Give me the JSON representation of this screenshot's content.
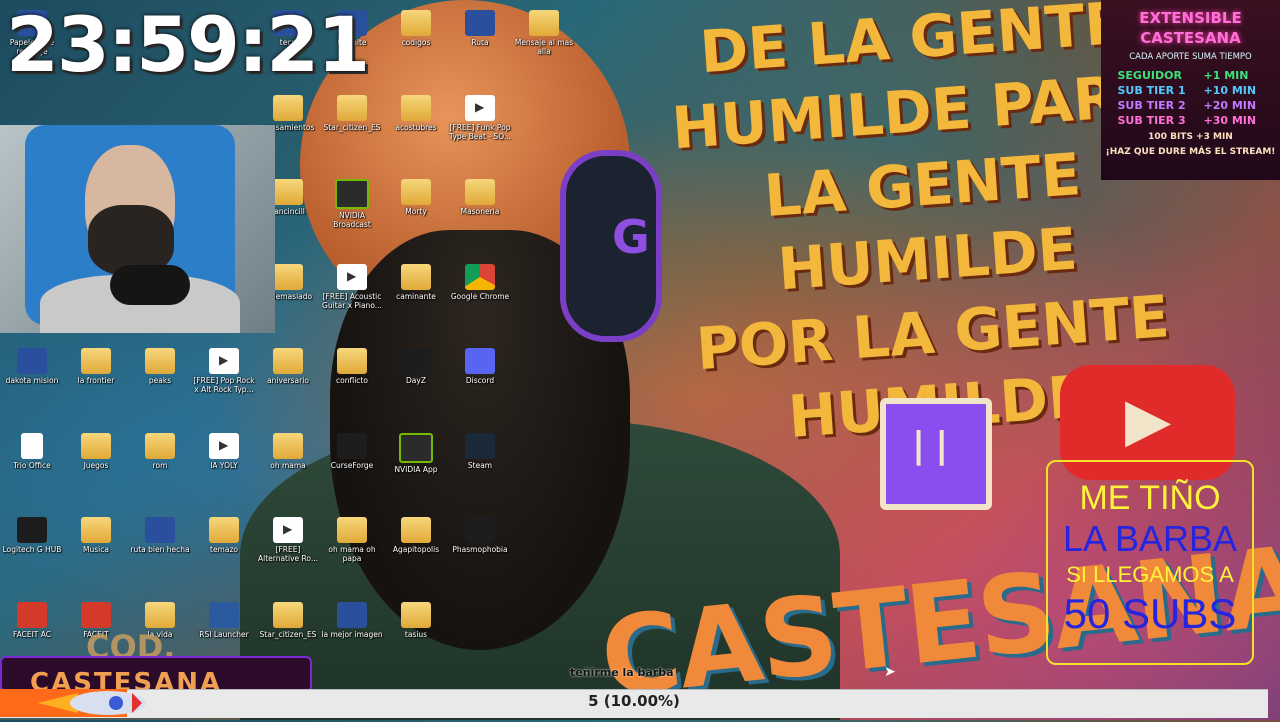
{
  "clock": "23:59:21",
  "slogan": {
    "lines": [
      "DE LA GENTE",
      "HUMILDE PARA",
      "LA GENTE HUMILDE",
      "POR LA GENTE",
      "HUMILDE"
    ]
  },
  "headphone_letter": "G",
  "brand_name": "CASTESANA",
  "desktop_icons": [
    {
      "label": "Papelera de reciclaje",
      "kind": "app"
    },
    {
      "label": "tecn",
      "kind": "app"
    },
    {
      "label": "Fortnite",
      "kind": "app"
    },
    {
      "label": "codigos",
      "kind": "folder"
    },
    {
      "label": "Ruta",
      "kind": "app"
    },
    {
      "label": "Mensaje al mas alla",
      "kind": "folder"
    },
    {
      "label": "pensamientos",
      "kind": "folder"
    },
    {
      "label": "Star_citizen_ES",
      "kind": "folder"
    },
    {
      "label": "acostubres",
      "kind": "folder"
    },
    {
      "label": "[FREE] Funk Pop Type Beat - SO...",
      "kind": "media"
    },
    {
      "label": "rancincill",
      "kind": "folder"
    },
    {
      "label": "NVIDIA Broadcast",
      "kind": "nvidia"
    },
    {
      "label": "Morty",
      "kind": "folder"
    },
    {
      "label": "Masoneria",
      "kind": "folder"
    },
    {
      "label": "e demasiado",
      "kind": "folder"
    },
    {
      "label": "[FREE] Acoustic Guitar x Piano...",
      "kind": "media"
    },
    {
      "label": "caminante",
      "kind": "folder"
    },
    {
      "label": "Google Chrome",
      "kind": "chrome"
    },
    {
      "label": "dakota mision",
      "kind": "app"
    },
    {
      "label": "la frontier",
      "kind": "folder"
    },
    {
      "label": "peaks",
      "kind": "folder"
    },
    {
      "label": "[FREE] Pop Rock x Alt Rock Typ...",
      "kind": "media"
    },
    {
      "label": "aniversario",
      "kind": "folder"
    },
    {
      "label": "conflicto",
      "kind": "folder"
    },
    {
      "label": "DayZ",
      "kind": "dark"
    },
    {
      "label": "Discord",
      "kind": "discord"
    },
    {
      "label": "Trio Office",
      "kind": "doc"
    },
    {
      "label": "Juegos",
      "kind": "folder"
    },
    {
      "label": "rom",
      "kind": "folder"
    },
    {
      "label": "IA YOLY",
      "kind": "media"
    },
    {
      "label": "oh mama",
      "kind": "folder"
    },
    {
      "label": "CurseForge",
      "kind": "dark"
    },
    {
      "label": "NVIDIA App",
      "kind": "nvidia"
    },
    {
      "label": "Steam",
      "kind": "steam"
    },
    {
      "label": "Logitech G HUB",
      "kind": "dark"
    },
    {
      "label": "Musica",
      "kind": "folder"
    },
    {
      "label": "ruta bien hecha",
      "kind": "app"
    },
    {
      "label": "temazo",
      "kind": "folder"
    },
    {
      "label": "[FREE] Alternative Ro...",
      "kind": "media"
    },
    {
      "label": "oh mama oh papa",
      "kind": "folder"
    },
    {
      "label": "Agapitopolis",
      "kind": "folder"
    },
    {
      "label": "Phasmophobia",
      "kind": "dark"
    },
    {
      "label": "FACEIT AC",
      "kind": "red"
    },
    {
      "label": "FACEIT",
      "kind": "red"
    },
    {
      "label": "la vida",
      "kind": "folder"
    },
    {
      "label": "RSI Launcher",
      "kind": "rsi"
    },
    {
      "label": "Star_citizen_ES",
      "kind": "folder"
    },
    {
      "label": "la mejor imagen",
      "kind": "app"
    },
    {
      "label": "tasius",
      "kind": "folder"
    }
  ],
  "extensible": {
    "title_line1": "EXTENSIBLE",
    "title_line2": "CASTESANA",
    "subtitle": "CADA APORTE SUMA TIEMPO",
    "rows": [
      {
        "label": "SEGUIDOR",
        "value": "+1 MIN",
        "color": "#3de07a"
      },
      {
        "label": "SUB TIER 1",
        "value": "+10 MIN",
        "color": "#54c8ff"
      },
      {
        "label": "SUB TIER 2",
        "value": "+20 MIN",
        "color": "#c07aff"
      },
      {
        "label": "SUB TIER 3",
        "value": "+30 MIN",
        "color": "#ff6fd8"
      }
    ],
    "bits": "100 BITS +3 MIN",
    "footer": "¡HAZ QUE DURE MÁS EL STREAM!"
  },
  "goal_box": {
    "line1": "ME TIÑO",
    "line2": "LA BARBA",
    "line3": "SI LLEGAMOS A",
    "line4": "50 SUBS"
  },
  "sub_goal": {
    "caption": "teñirme la barba",
    "text": "5 (10.00%)",
    "progress": 0.1,
    "fill_color": "#ff6a1a"
  },
  "cod_text": "COD."
}
